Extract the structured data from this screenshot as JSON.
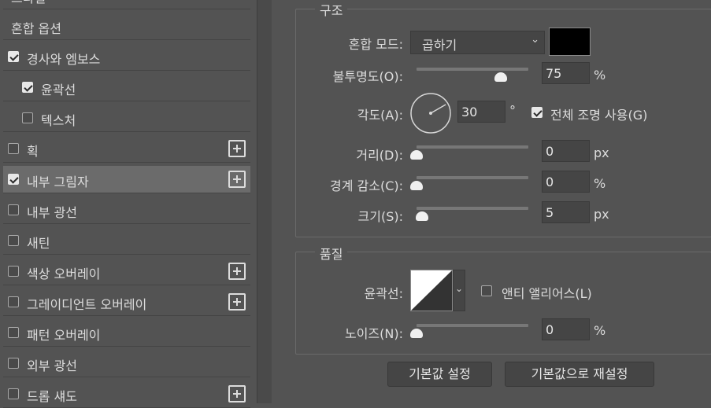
{
  "styles_list": [
    {
      "label": "스타일",
      "checkbox": false,
      "checked": false,
      "plus": false,
      "selected": false,
      "indent": 0
    },
    {
      "label": "혼합 옵션",
      "checkbox": false,
      "checked": false,
      "plus": false,
      "selected": false,
      "indent": 0
    },
    {
      "label": "경사와 엠보스",
      "checkbox": true,
      "checked": true,
      "plus": false,
      "selected": false,
      "indent": 0
    },
    {
      "label": "윤곽선",
      "checkbox": true,
      "checked": true,
      "plus": false,
      "selected": false,
      "indent": 1
    },
    {
      "label": "텍스처",
      "checkbox": true,
      "checked": false,
      "plus": false,
      "selected": false,
      "indent": 1
    },
    {
      "label": "획",
      "checkbox": true,
      "checked": false,
      "plus": true,
      "selected": false,
      "indent": 0
    },
    {
      "label": "내부 그림자",
      "checkbox": true,
      "checked": true,
      "plus": true,
      "selected": true,
      "indent": 0
    },
    {
      "label": "내부 광선",
      "checkbox": true,
      "checked": false,
      "plus": false,
      "selected": false,
      "indent": 0
    },
    {
      "label": "새틴",
      "checkbox": true,
      "checked": false,
      "plus": false,
      "selected": false,
      "indent": 0
    },
    {
      "label": "색상 오버레이",
      "checkbox": true,
      "checked": false,
      "plus": true,
      "selected": false,
      "indent": 0
    },
    {
      "label": "그레이디언트 오버레이",
      "checkbox": true,
      "checked": false,
      "plus": true,
      "selected": false,
      "indent": 0
    },
    {
      "label": "패턴 오버레이",
      "checkbox": true,
      "checked": false,
      "plus": false,
      "selected": false,
      "indent": 0
    },
    {
      "label": "외부 광선",
      "checkbox": true,
      "checked": false,
      "plus": false,
      "selected": false,
      "indent": 0
    },
    {
      "label": "드롭 섀도",
      "checkbox": true,
      "checked": false,
      "plus": true,
      "selected": false,
      "indent": 0
    }
  ],
  "structure": {
    "title": "구조",
    "blend_mode_label": "혼합 모드:",
    "blend_mode_value": "곱하기",
    "blend_color": "#000000",
    "opacity_label": "불투명도(O):",
    "opacity_value": "75",
    "opacity_unit": "%",
    "opacity_level": 75,
    "angle_label": "각도(A):",
    "angle_value": "30",
    "angle_unit": "°",
    "global_light_label": "전체 조명 사용(G)",
    "global_light_checked": true,
    "distance_label": "거리(D):",
    "distance_value": "0",
    "distance_unit": "px",
    "distance_level": 0,
    "choke_label": "경계 감소(C):",
    "choke_value": "0",
    "choke_unit": "%",
    "choke_level": 0,
    "size_label": "크기(S):",
    "size_value": "5",
    "size_unit": "px",
    "size_level": 5
  },
  "quality": {
    "title": "품질",
    "contour_label": "윤곽선:",
    "anti_alias_label": "앤티 앨리어스(L)",
    "anti_alias_checked": false,
    "noise_label": "노이즈(N):",
    "noise_value": "0",
    "noise_unit": "%",
    "noise_level": 0
  },
  "buttons": {
    "make_default": "기본값 설정",
    "reset_default": "기본값으로 재설정"
  }
}
